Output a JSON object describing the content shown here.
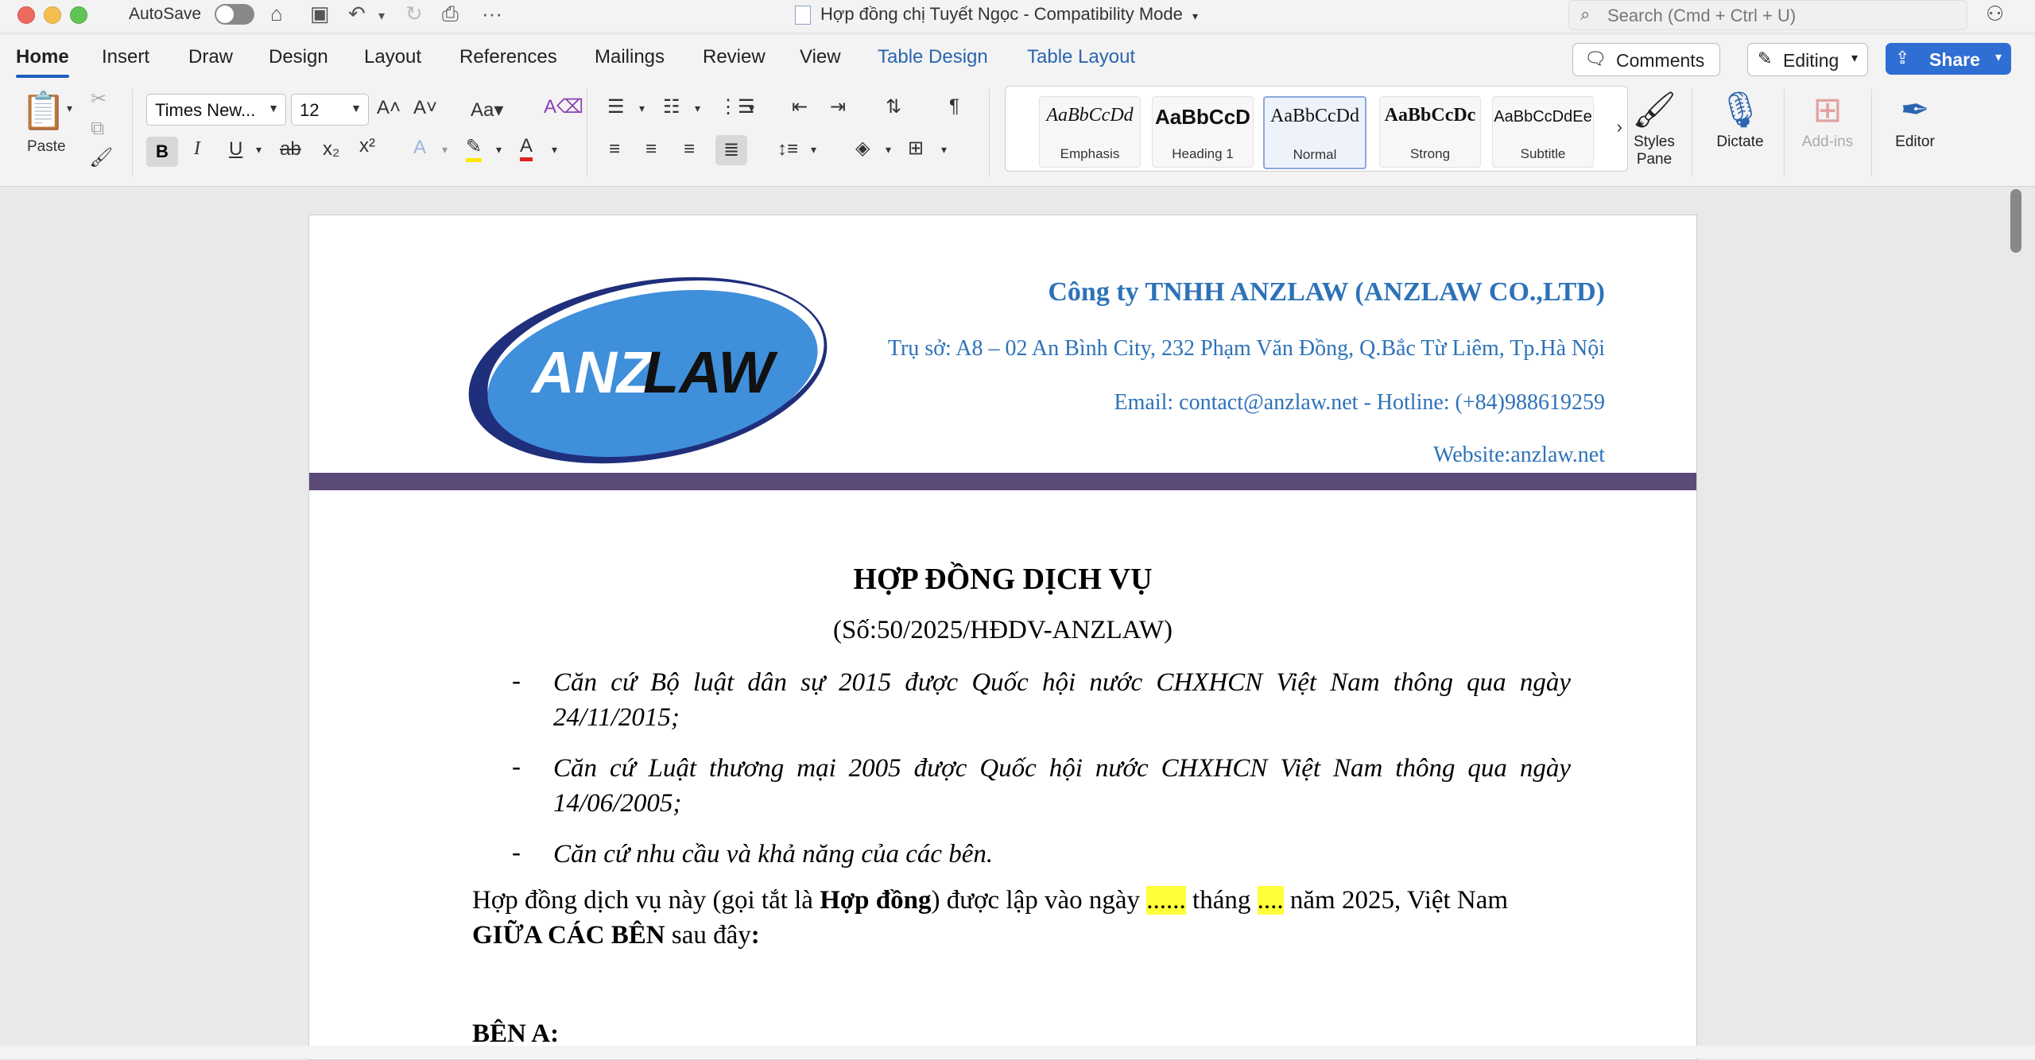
{
  "titlebar": {
    "autosave_label": "AutoSave",
    "document_title": "Hợp đồng chị Tuyết Ngọc  -  Compatibility Mode",
    "search_placeholder": "Search (Cmd + Ctrl + U)"
  },
  "tabs": [
    "Home",
    "Insert",
    "Draw",
    "Design",
    "Layout",
    "References",
    "Mailings",
    "Review",
    "View",
    "Table Design",
    "Table Layout"
  ],
  "actions": {
    "comments": "Comments",
    "editing": "Editing",
    "share": "Share"
  },
  "ribbon": {
    "paste_label": "Paste",
    "font_name": "Times New...",
    "font_size": "12",
    "bold": "B",
    "italic": "I",
    "underline": "U",
    "strike": "ab",
    "styles": [
      {
        "preview": "AaBbCcDd",
        "name": "Emphasis"
      },
      {
        "preview": "AaBbCcD",
        "name": "Heading 1"
      },
      {
        "preview": "AaBbCcDd",
        "name": "Normal"
      },
      {
        "preview": "AaBbCcDc",
        "name": "Strong"
      },
      {
        "preview": "AaBbCcDdEe",
        "name": "Subtitle"
      }
    ],
    "styles_pane_line1": "Styles",
    "styles_pane_line2": "Pane",
    "dictate": "Dictate",
    "addins": "Add-ins",
    "editor": "Editor"
  },
  "document": {
    "logo_text_left": "ANZ",
    "logo_text_right": "LAW",
    "company": "Công ty TNHH ANZLAW (ANZLAW CO.,LTD)",
    "address": "Trụ sở: A8 – 02 An Bình City, 232 Phạm Văn Đồng, Q.Bắc Từ Liêm, Tp.Hà Nội",
    "contact": "Email: contact@anzlaw.net -  Hotline: (+84)988619259",
    "website": "Website:anzlaw.net",
    "title": "HỢP ĐỒNG DỊCH VỤ",
    "number": "(Số:50/2025/HĐDV-ANZLAW)",
    "bullet_char": "-",
    "bullets": [
      {
        "line1": "Căn cứ Bộ luật dân sự 2015 được Quốc hội nước CHXHCN Việt Nam thông qua ngày",
        "line2": "24/11/2015;"
      },
      {
        "line1": "Căn cứ Luật thương mại 2005 được Quốc hội nước CHXHCN Việt Nam thông qua ngày",
        "line2": "14/06/2005;"
      },
      {
        "line1": "Căn cứ nhu cầu và khả năng của các bên.",
        "line2": ""
      }
    ],
    "para_part1": "Hợp đồng dịch vụ này (gọi tắt là ",
    "para_bold": "Hợp đồng",
    "para_part2": ") được lập vào ngày ",
    "para_day": "......",
    "para_part3": " tháng ",
    "para_month": "....",
    "para_part4": " năm 2025, Việt Nam",
    "para_bold2": "GIỮA CÁC BÊN",
    "para_part5": " sau đây",
    "para_colon": ":",
    "party_a": "BÊN A:"
  },
  "colors": {
    "accent": "#2f6ed3",
    "brand_blue": "#2d72b8",
    "band": "#5b4a78",
    "highlight": "#ffff3a"
  }
}
